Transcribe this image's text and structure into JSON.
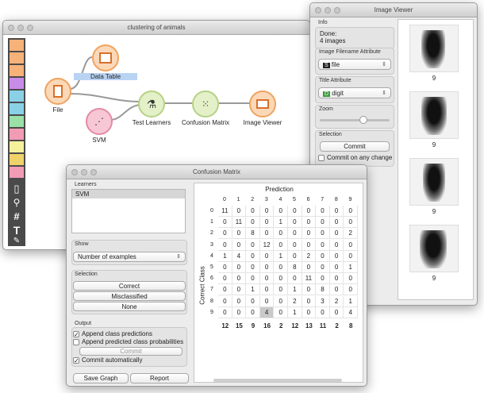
{
  "canvas": {
    "title": "clustering of animals",
    "nodes": {
      "data_table": "Data Table",
      "file": "File",
      "svm": "SVM",
      "test_learners": "Test Learners",
      "confusion_matrix": "Confusion Matrix",
      "image_viewer": "Image Viewer"
    },
    "toolbar_icons": [
      "table-icon",
      "scatter-icon",
      "network-icon",
      "curve-icon",
      "heatmap-icon",
      "mosaic-icon",
      "line-icon",
      "scatter2-icon",
      "radviz-icon",
      "cube-icon",
      "sieve-icon",
      "document-icon",
      "search-icon",
      "hash-icon",
      "text-icon",
      "pen-icon"
    ]
  },
  "image_viewer": {
    "title": "Image Viewer",
    "info_label": "Info",
    "info_line1": "Done:",
    "info_line2": "4 images",
    "filename_label": "Image Filename Attribute",
    "filename_value": "file",
    "title_attr_label": "Title Attribute",
    "title_attr_value": "digit",
    "zoom_label": "Zoom",
    "zoom_level": 0.6,
    "selection_label": "Selection",
    "commit_button": "Commit",
    "commit_any": "Commit on any change",
    "image_captions": [
      "9",
      "9",
      "9",
      "9"
    ]
  },
  "confusion_matrix": {
    "title": "Confusion Matrix",
    "learners_label": "Learners",
    "learners": [
      "SVM"
    ],
    "show_label": "Show",
    "show_value": "Number of examples",
    "selection_label": "Selection",
    "correct_button": "Correct",
    "misclassified_button": "Misclassified",
    "none_button": "None",
    "output_label": "Output",
    "append_predictions": "Append class predictions",
    "append_probabilities": "Append predicted class probabilities",
    "commit_button": "Commit",
    "commit_auto": "Commit automatically",
    "save_graph": "Save Graph",
    "report": "Report",
    "prediction_label": "Prediction",
    "correct_class_label": "Correct Class",
    "classes": [
      "0",
      "1",
      "2",
      "3",
      "4",
      "5",
      "6",
      "7",
      "8",
      "9"
    ],
    "matrix": [
      [
        11,
        0,
        0,
        0,
        0,
        0,
        0,
        0,
        0,
        0
      ],
      [
        0,
        11,
        0,
        0,
        1,
        0,
        0,
        0,
        0,
        0
      ],
      [
        0,
        0,
        8,
        0,
        0,
        0,
        0,
        0,
        0,
        2
      ],
      [
        0,
        0,
        0,
        12,
        0,
        0,
        0,
        0,
        0,
        0
      ],
      [
        1,
        4,
        0,
        0,
        1,
        0,
        2,
        0,
        0,
        0
      ],
      [
        0,
        0,
        0,
        0,
        0,
        8,
        0,
        0,
        0,
        1
      ],
      [
        0,
        0,
        0,
        0,
        0,
        0,
        11,
        0,
        0,
        0
      ],
      [
        0,
        0,
        1,
        0,
        0,
        1,
        0,
        8,
        0,
        0
      ],
      [
        0,
        0,
        0,
        0,
        0,
        2,
        0,
        3,
        2,
        1
      ],
      [
        0,
        0,
        0,
        4,
        0,
        1,
        0,
        0,
        0,
        4
      ]
    ],
    "totals": [
      12,
      15,
      9,
      16,
      2,
      12,
      13,
      11,
      2,
      8
    ]
  }
}
